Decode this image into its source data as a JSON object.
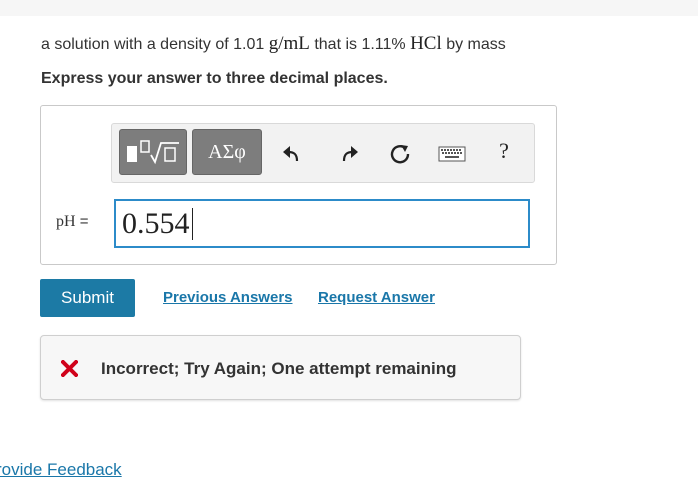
{
  "problem": {
    "prefix": "a solution with a density of 1.01 ",
    "density_unit": "g/mL",
    "middle": " that is 1.11% ",
    "compound": "HCl",
    "suffix": " by mass"
  },
  "instruction": "Express your answer to three decimal places.",
  "toolbar": {
    "greek_label": "ΑΣφ",
    "help_label": "?",
    "icons": [
      "templates-icon",
      "greek-letters-icon",
      "undo-icon",
      "redo-icon",
      "reset-icon",
      "keyboard-icon",
      "help-icon"
    ]
  },
  "answer": {
    "label": "pH",
    "equals": " =",
    "value": "0.554"
  },
  "buttons": {
    "submit": "Submit",
    "previous_answers": "Previous Answers",
    "request_answer": "Request Answer"
  },
  "feedback": {
    "message": "Incorrect; Try Again; One attempt remaining",
    "icon": "x-icon",
    "icon_color": "#d0021b"
  },
  "footer": {
    "provide_feedback": "rovide Feedback"
  },
  "colors": {
    "accent": "#1c7aa5",
    "link": "#1a77a9",
    "input_border": "#2c8bc9"
  }
}
